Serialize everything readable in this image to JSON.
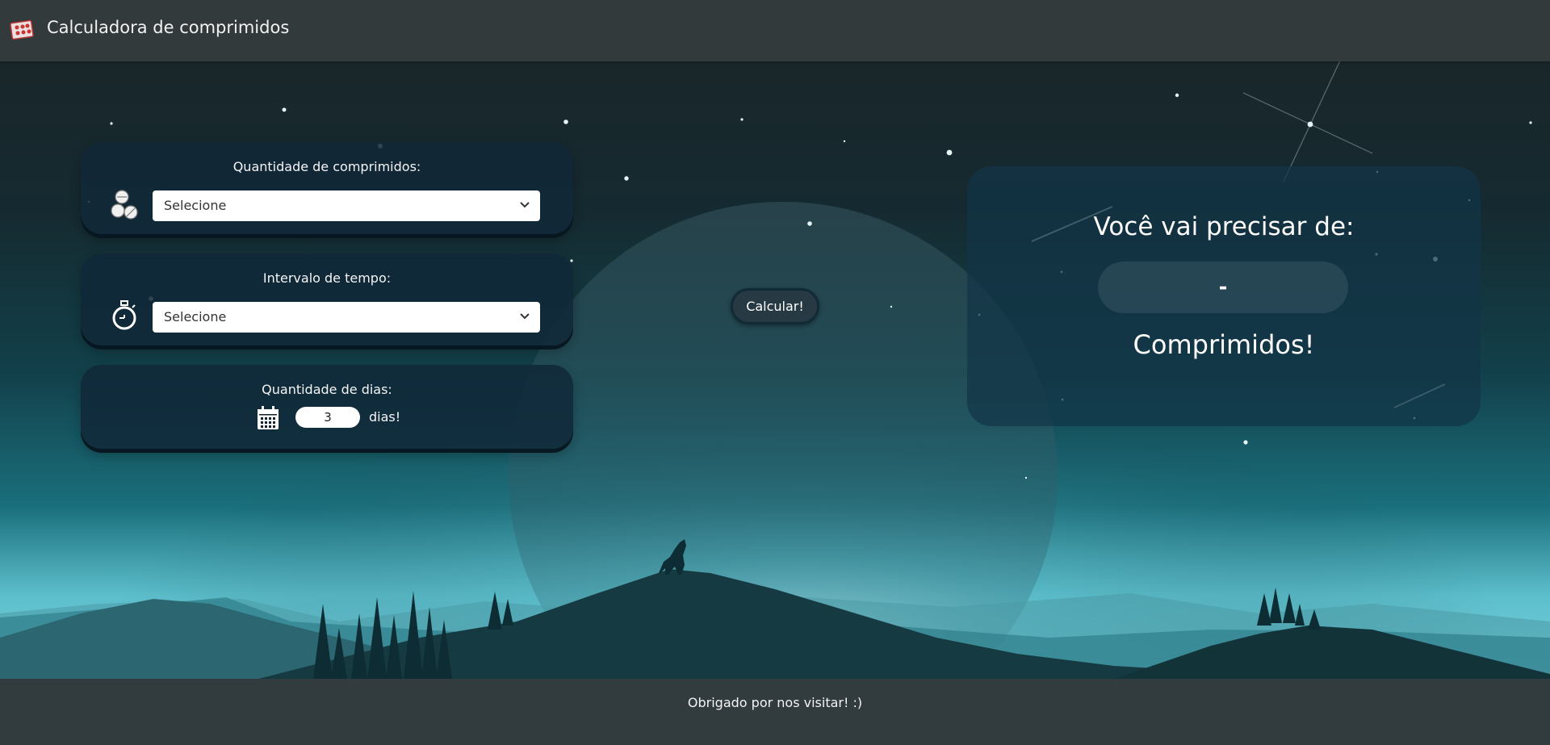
{
  "header": {
    "title": "Calculadora de comprimidos"
  },
  "form": {
    "pills": {
      "label": "Quantidade de comprimidos:",
      "selected": "Selecione"
    },
    "interval": {
      "label": "Intervalo de tempo:",
      "selected": "Selecione"
    },
    "days": {
      "label": "Quantidade de dias:",
      "value": "3",
      "suffix": "dias!"
    }
  },
  "calculate_button": {
    "label": "Calcular!"
  },
  "result": {
    "title": "Você vai precisar de:",
    "value": "-",
    "unit": "Comprimidos!"
  },
  "footer": {
    "text": "Obrigado por nos visitar! :)"
  },
  "colors": {
    "navbar": "#333a3c",
    "card": "#10283a",
    "footer": "#323b3e",
    "sky_glow": "#a6e8f2"
  }
}
